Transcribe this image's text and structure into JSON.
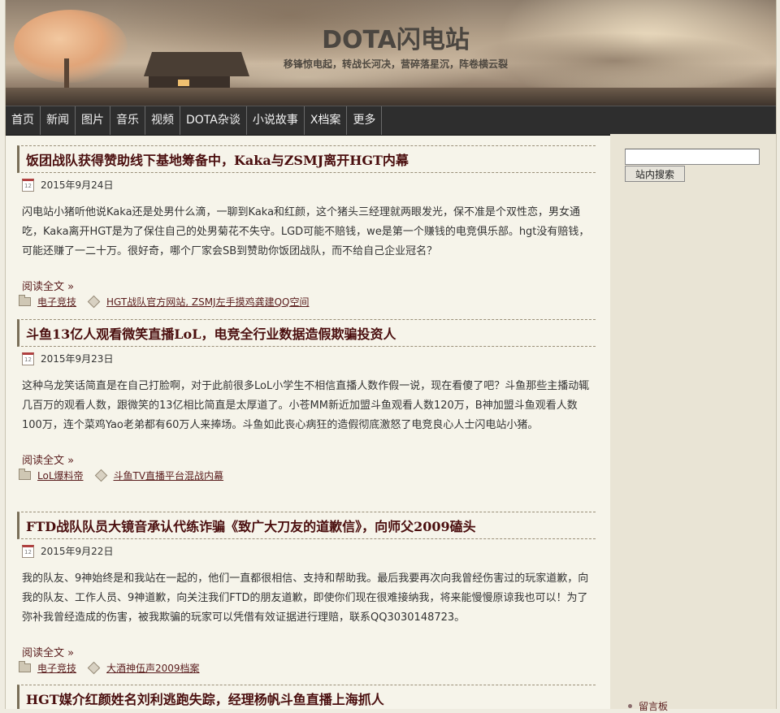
{
  "header": {
    "title": "DOTA闪电站",
    "tagline": "移锋惊电起，转战长河决，营碎落星沉，阵卷横云裂"
  },
  "nav": {
    "items": [
      "首页",
      "新闻",
      "图片",
      "音乐",
      "视频",
      "DOTA杂谈",
      "小说故事",
      "X档案",
      "更多"
    ]
  },
  "posts": [
    {
      "title": "饭团战队获得赞助线下基地筹备中，Kaka与ZSMJ离开HGT内幕",
      "date": "2015年9月24日",
      "body": "闪电站小猪听他说Kaka还是处男什么滴，一聊到Kaka和红颜，这个猪头三经理就两眼发光，保不准是个双性恋，男女通吃，Kaka离开HGT是为了保住自己的处男菊花不失守。LGD可能不赔钱，we是第一个赚钱的电竞俱乐部。hgt没有赔钱，可能还赚了一二十万。很好奇，哪个厂家会SB到赞助你饭团战队，而不给自己企业冠名？",
      "read_more": "阅读全文 »",
      "category": "电子竞技",
      "tags": "HGT战队官方网站, ZSMJ左手摸鸡龚建QQ空间"
    },
    {
      "title": "斗鱼13亿人观看微笑直播LoL，电竞全行业数据造假欺骗投资人",
      "date": "2015年9月23日",
      "body": "这种乌龙笑话简直是在自己打脸啊，对于此前很多LoL小学生不相信直播人数作假一说，现在看傻了吧？斗鱼那些主播动辄几百万的观看人数，跟微笑的13亿相比简直是太厚道了。小苍MM新近加盟斗鱼观看人数120万，B神加盟斗鱼观看人数100万，连个菜鸡Yao老弟都有60万人来捧场。斗鱼如此丧心病狂的造假彻底激怒了电竞良心人士闪电站小猪。",
      "read_more": "阅读全文 »",
      "category": "LoL爆料帝",
      "tags": "斗鱼TV直播平台混战内幕"
    },
    {
      "title": "FTD战队队员大镜音承认代练诈骗《致广大刀友的道歉信》，向师父2009磕头",
      "date": "2015年9月22日",
      "body": "我的队友、9神始终是和我站在一起的，他们一直都很相信、支持和帮助我。最后我要再次向我曾经伤害过的玩家道歉，向我的队友、工作人员、9神道歉，向关注我们FTD的朋友道歉，即使你们现在很难接纳我，将来能慢慢原谅我也可以！为了弥补我曾经造成的伤害，被我欺骗的玩家可以凭借有效证据进行理赔，联系QQ3030148723。",
      "read_more": "阅读全文 »",
      "category": "电子竞技",
      "tags": "大酒神伍声2009档案"
    },
    {
      "title": "HGT媒介红颜姓名刘利逃跑失踪，经理杨帆斗鱼直播上海抓人"
    }
  ],
  "sidebar": {
    "search_button": "站内搜索",
    "search_value": "",
    "guestbook": "留言板"
  }
}
